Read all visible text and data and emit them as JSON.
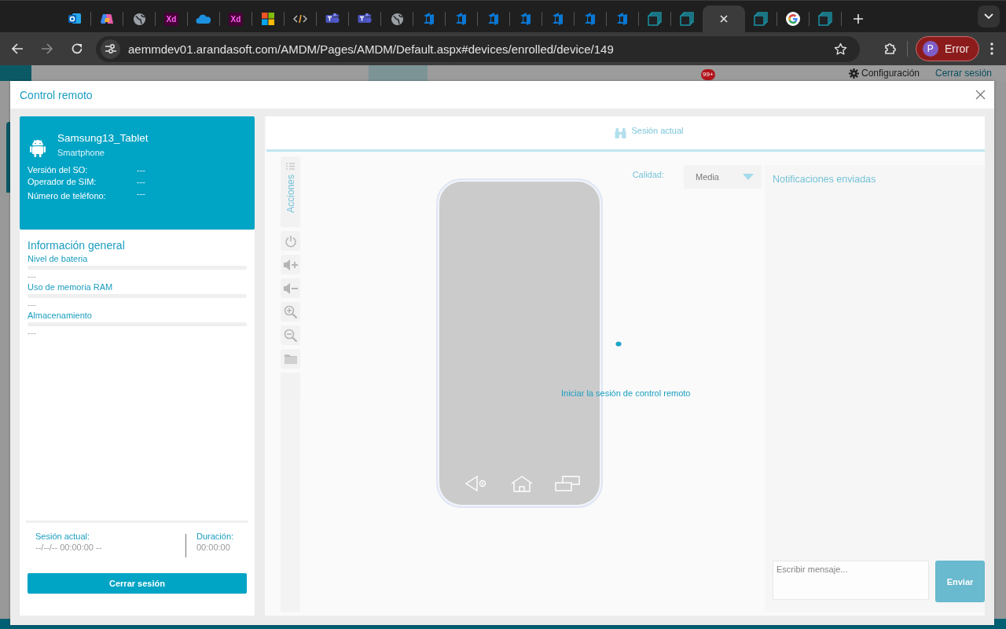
{
  "browser": {
    "tabs": [
      {
        "kind": "outlook",
        "selected": false
      },
      {
        "kind": "copilot",
        "selected": false
      },
      {
        "kind": "globe",
        "selected": false
      },
      {
        "kind": "xd",
        "label": "Xd",
        "selected": false
      },
      {
        "kind": "onedrive",
        "selected": false
      },
      {
        "kind": "xd",
        "label": "Xd",
        "selected": false
      },
      {
        "kind": "microsoft",
        "selected": false
      },
      {
        "kind": "code",
        "selected": false
      },
      {
        "kind": "teams",
        "selected": false
      },
      {
        "kind": "teams",
        "selected": false
      },
      {
        "kind": "globe",
        "selected": false
      },
      {
        "kind": "azure",
        "selected": false
      },
      {
        "kind": "azure",
        "selected": false
      },
      {
        "kind": "azure",
        "selected": false
      },
      {
        "kind": "azure",
        "selected": false
      },
      {
        "kind": "azure",
        "selected": false
      },
      {
        "kind": "azure",
        "selected": false
      },
      {
        "kind": "azure",
        "selected": false
      },
      {
        "kind": "pages",
        "selected": false
      },
      {
        "kind": "pages",
        "selected": false
      },
      {
        "kind": "blank",
        "selected": true
      },
      {
        "kind": "pages",
        "selected": false
      },
      {
        "kind": "google",
        "selected": false
      },
      {
        "kind": "pages",
        "selected": false
      }
    ],
    "url": "aemmdev01.arandasoft.com/AMDM/Pages/AMDM/Default.aspx#devices/enrolled/device/149",
    "profile": {
      "initial": "P",
      "label": "Error"
    }
  },
  "app_bar": {
    "badge": "99+",
    "settings": "Configuración",
    "logout": "Cerrar sesión"
  },
  "dialog": {
    "title": "Control remoto"
  },
  "device": {
    "name": "Samsung13_Tablet",
    "type": "Smartphone",
    "fields": [
      {
        "label": "Versión del SO:",
        "value": "---"
      },
      {
        "label": "Operador de SIM:",
        "value": "---"
      },
      {
        "label": "Número de teléfono:",
        "value": "---"
      }
    ]
  },
  "general_info": {
    "title": "Información general",
    "meters": [
      {
        "label": "Nivel de bateria",
        "level": 0,
        "reading": "---"
      },
      {
        "label": "Uso de memoria RAM",
        "level": 0,
        "reading": "---"
      },
      {
        "label": "Almacenamiento",
        "level": 0,
        "reading": "---"
      }
    ]
  },
  "session": {
    "current_label": "Sesión actual:",
    "current_value": "--/--/-- 00:00:00 --",
    "duration_label": "Duración:",
    "duration_value": "00:00:00"
  },
  "close_session_button": "Cerrar sesión",
  "remote": {
    "disabled": true,
    "tab": {
      "label": "Sesión actual",
      "selected": true
    },
    "actions_label": "Acciones",
    "quality_label": "Calidad:",
    "quality_value": "Media",
    "start_link": "Iniciar la sesión de control remoto",
    "notifications_title": "Notificaciones enviadas",
    "message_placeholder": "Escribir mensaje...",
    "send_button": "Enviar"
  }
}
